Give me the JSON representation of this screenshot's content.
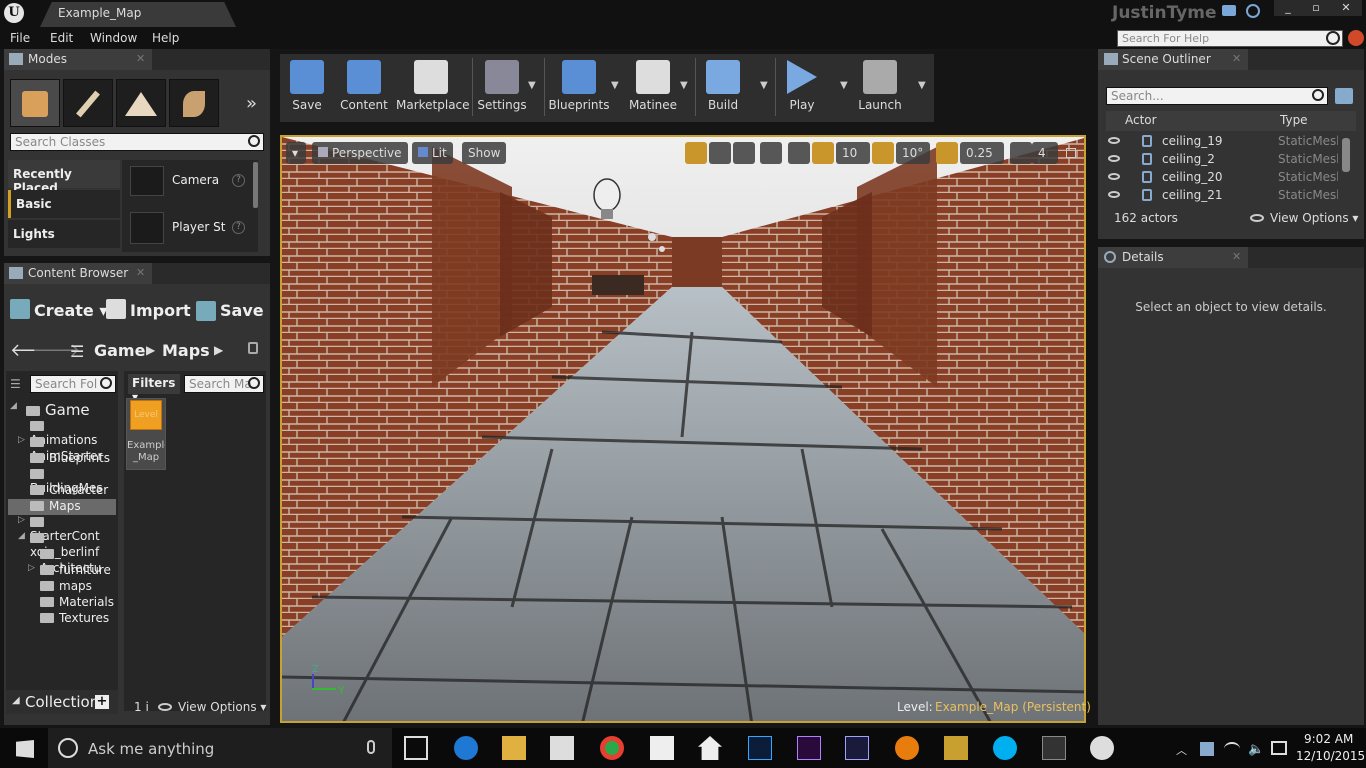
{
  "window": {
    "tab_title": "Example_Map",
    "user": "JustinTyme"
  },
  "menu": [
    "File",
    "Edit",
    "Window",
    "Help"
  ],
  "help_search_placeholder": "Search For Help",
  "modes": {
    "tab": "Modes",
    "search_placeholder": "Search Classes",
    "categories": [
      "Recently Placed",
      "Basic",
      "Lights"
    ],
    "items": [
      "Camera",
      "Player St"
    ]
  },
  "toolbar": [
    "Save",
    "Content",
    "Marketplace",
    "Settings",
    "Blueprints",
    "Matinee",
    "Build",
    "Play",
    "Launch"
  ],
  "viewport": {
    "perspective": "Perspective",
    "lit": "Lit",
    "show": "Show",
    "grid": "10",
    "rot": "10°",
    "scale": "0.25",
    "cam": "4",
    "level_label": "Level:",
    "level_name": "Example_Map (Persistent)",
    "axis_z": "Z",
    "axis_y": "Y"
  },
  "content_browser": {
    "tab": "Content Browser",
    "create": "Create",
    "import": "Import",
    "save": "Save",
    "path": [
      "Game",
      "Maps"
    ],
    "search_folders": "Search Fol",
    "filters": "Filters",
    "search_maps": "Search Ma",
    "tree": [
      {
        "label": "Game",
        "level": 0
      },
      {
        "label": "Animations",
        "level": 1
      },
      {
        "label": "AnimStarter",
        "level": 1
      },
      {
        "label": "Blueprints",
        "level": 1
      },
      {
        "label": "BuildingMes",
        "level": 1
      },
      {
        "label": "Character",
        "level": 1
      },
      {
        "label": "Maps",
        "level": 1
      },
      {
        "label": "StarterCont",
        "level": 1
      },
      {
        "label": "xoio_berlinf",
        "level": 1
      },
      {
        "label": "Architectu",
        "level": 2
      },
      {
        "label": "furniture",
        "level": 2
      },
      {
        "label": "maps",
        "level": 2
      },
      {
        "label": "Materials",
        "level": 2
      },
      {
        "label": "Textures",
        "level": 2
      }
    ],
    "asset": {
      "badge": "Level",
      "name1": "Example",
      "name2": "_Map"
    },
    "collections": "Collection",
    "count": "1 i",
    "view_options": "View Options"
  },
  "outliner": {
    "tab": "Scene Outliner",
    "search_placeholder": "Search...",
    "col_actor": "Actor",
    "col_type": "Type",
    "rows": [
      {
        "name": "ceiling_19",
        "type": "StaticMesh"
      },
      {
        "name": "ceiling_2",
        "type": "StaticMesh"
      },
      {
        "name": "ceiling_20",
        "type": "StaticMesh"
      },
      {
        "name": "ceiling_21",
        "type": "StaticMesh"
      }
    ],
    "actors": "162 actors",
    "view_options": "View Options"
  },
  "details": {
    "tab": "Details",
    "empty": "Select an object to view details."
  },
  "taskbar": {
    "search": "Ask me anything",
    "time": "9:02 AM",
    "date": "12/10/2015"
  }
}
